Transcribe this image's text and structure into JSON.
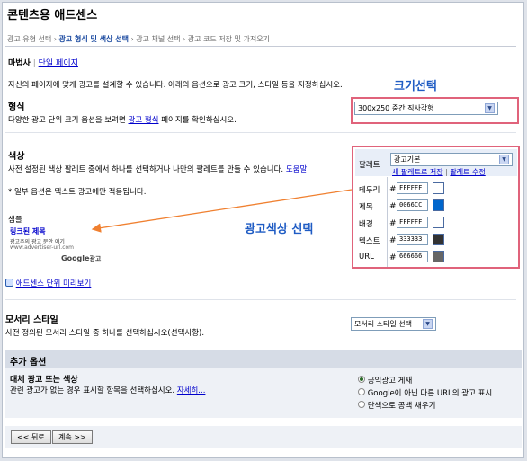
{
  "header": {
    "title": "콘텐츠용 애드센스",
    "steps": [
      "광고 유형 선택",
      "광고 형식 및 색상 선택",
      "광고 채널 선택",
      "광고 코드 저장 및 가져오기"
    ],
    "step_sep": "›"
  },
  "wizard": {
    "label": "마법사",
    "divider": "|",
    "single_page_link": "단일 페이지",
    "intro": "자신의 페이지에 맞게 광고를 설계할 수 있습니다. 아래의 옵션으로 광고 크기, 스타일 등을 지정하십시오."
  },
  "annotations": {
    "size_select": "크기선택",
    "ad_color_select": "광고색상 선택"
  },
  "format": {
    "title": "형식",
    "desc_before": "다양한 광고 단위 크기 옵션을 보려면 ",
    "desc_link": "광고 형식",
    "desc_after": " 페이지를 확인하십시오.",
    "selected": "300x250 중간 직사각형"
  },
  "colors": {
    "title": "색상",
    "desc_before": "사전 설정된 색상 팔레트 중에서 하나를 선택하거나 나만의 팔레트를 만들 수 있습니다. ",
    "desc_link": "도움말",
    "note": "* 일부 옵션은 텍스트 광고에만 적용됩니다.",
    "palette_label": "팔레트",
    "palette_selected": "광고기본",
    "save_palette_link": "새 팔레트로 저장",
    "palette_sep": "|",
    "edit_palette_link": "팔레트 수정",
    "hash": "#",
    "rows": [
      {
        "label": "테두리",
        "value": "FFFFFF",
        "color": "#FFFFFF"
      },
      {
        "label": "제목",
        "value": "0066CC",
        "color": "#0066CC"
      },
      {
        "label": "배경",
        "value": "FFFFFF",
        "color": "#FFFFFF"
      },
      {
        "label": "텍스트",
        "value": "333333",
        "color": "#333333"
      },
      {
        "label": "URL",
        "value": "666666",
        "color": "#666666"
      }
    ]
  },
  "sample": {
    "label": "샘플",
    "ad_title": "링크된 제목",
    "ad_text": "광고주의 광고 문안 여기",
    "ad_url": "www.advertiser-url.com",
    "google_brand": "Google",
    "google_suffix": "광고",
    "preview_link": "애드센스 단위 미리보기"
  },
  "corner_style": {
    "title": "모서리 스타일",
    "desc": "사전 정의된 모서리 스타일 중 하나를 선택하십시오(선택사항).",
    "selected": "모서리 스타일 선택"
  },
  "additional": {
    "header": "추가 옵션",
    "subtitle": "대체 광고 또는 색상",
    "desc": "관련 광고가 없는 경우 표시할 항목을 선택하십시오.",
    "more_link": "자세히...",
    "options": [
      "공익광고 게재",
      "Google이 아닌 다른 URL의 광고 표시",
      "단색으로 공백 채우기"
    ],
    "selected_index": 0
  },
  "nav": {
    "back": "<< 뒤로",
    "next": "계속 >>"
  }
}
